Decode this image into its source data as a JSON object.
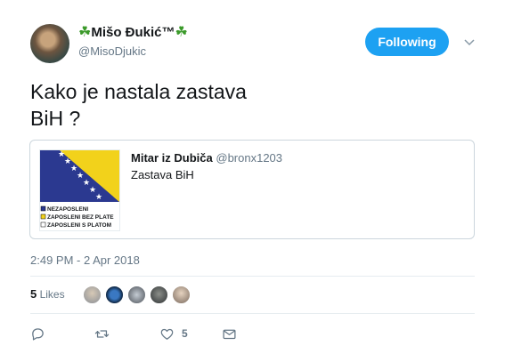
{
  "author": {
    "name": "Mišo Đukić™",
    "name_prefix_icon": "shamrock-icon",
    "name_suffix_icon": "shamrock-icon",
    "handle": "@MisoDjukic"
  },
  "follow_button": {
    "label": "Following",
    "color": "#1da1f2"
  },
  "tweet": {
    "text_line1": "Kako je nastala zastava",
    "text_line2": "BiH ?"
  },
  "quoted": {
    "name": "Mitar iz Dubiča",
    "handle": "@bronx1203",
    "text": "Zastava BiH",
    "image_legend": [
      {
        "label": "NEZAPOSLENI",
        "color": "#2b3990"
      },
      {
        "label": "ZAPOSLENI BEZ PLATE",
        "color": "#f2d21b"
      },
      {
        "label": "ZAPOSLENI S PLATOM",
        "color": "#ffffff"
      }
    ]
  },
  "timestamp": "2:49 PM - 2 Apr 2018",
  "likes": {
    "count": "5",
    "label": "Likes"
  },
  "actions": {
    "reply_icon": "reply-icon",
    "retweet_icon": "retweet-icon",
    "like_icon": "heart-icon",
    "like_count": "5",
    "dm_icon": "envelope-icon"
  }
}
